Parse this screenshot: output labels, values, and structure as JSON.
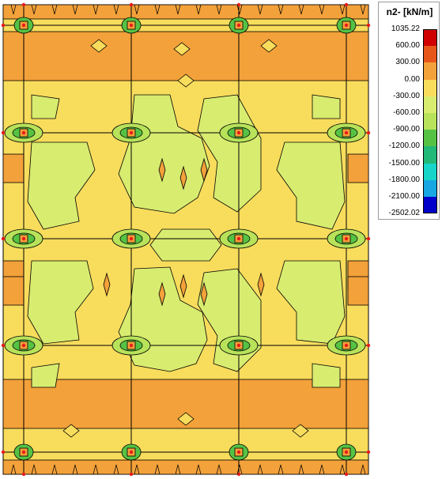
{
  "legend": {
    "title": "n2- [kN/m]",
    "levels": [
      {
        "label": "1035.22",
        "color": "#d00000"
      },
      {
        "label": "600.00",
        "color": "#e8571a"
      },
      {
        "label": "300.00",
        "color": "#f3a13a"
      },
      {
        "label": "0.00",
        "color": "#f8dc5c"
      },
      {
        "label": "-300.00",
        "color": "#d8ec70"
      },
      {
        "label": "-600.00",
        "color": "#b7e25a"
      },
      {
        "label": "-900.00",
        "color": "#56c244"
      },
      {
        "label": "-1200.00",
        "color": "#21b878"
      },
      {
        "label": "-1500.00",
        "color": "#17d6c9"
      },
      {
        "label": "-1800.00",
        "color": "#18a7e2"
      },
      {
        "label": "-2100.00",
        "color": "#2466e6"
      },
      {
        "label": "-2502.02",
        "color": "#0000c8"
      }
    ]
  },
  "colors": {
    "band_orange": "#f3a13a",
    "field_yellow": "#f8dc5c",
    "field_lightgreen": "#d8ec70",
    "node_red": "#e81a1a",
    "grid_line": "#000000"
  }
}
